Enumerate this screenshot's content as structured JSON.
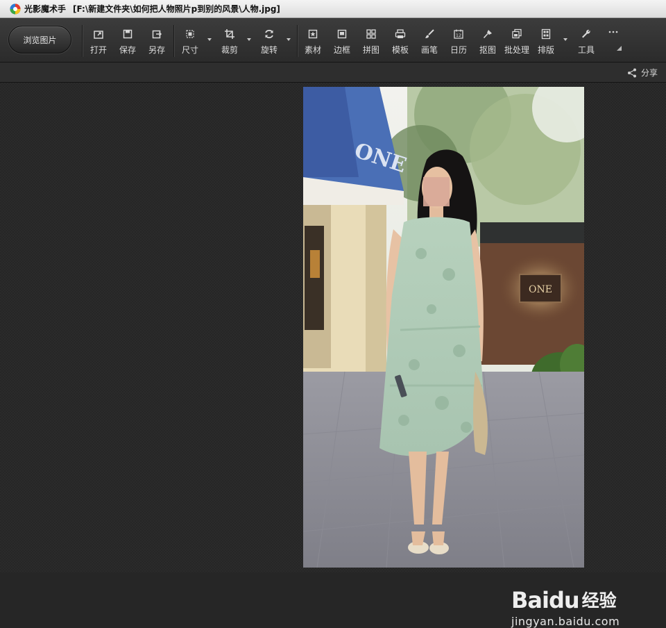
{
  "window": {
    "app_name": "光影魔术手",
    "file_path": "[F:\\新建文件夹\\如何把人物照片p到别的风景\\人物.jpg]"
  },
  "toolbar": {
    "browse_label": "浏览图片",
    "tools": [
      {
        "label": "打开",
        "icon": "open-icon"
      },
      {
        "label": "保存",
        "icon": "save-icon"
      },
      {
        "label": "另存",
        "icon": "save-as-icon"
      },
      {
        "label": "尺寸",
        "icon": "resize-icon"
      },
      {
        "label": "裁剪",
        "icon": "crop-icon"
      },
      {
        "label": "旋转",
        "icon": "rotate-icon"
      },
      {
        "label": "素材",
        "icon": "material-icon"
      },
      {
        "label": "边框",
        "icon": "border-icon"
      },
      {
        "label": "拼图",
        "icon": "collage-icon"
      },
      {
        "label": "模板",
        "icon": "template-icon"
      },
      {
        "label": "画笔",
        "icon": "brush-icon"
      },
      {
        "label": "日历",
        "icon": "calendar-icon"
      },
      {
        "label": "抠图",
        "icon": "cutout-icon"
      },
      {
        "label": "批处理",
        "icon": "batch-icon"
      },
      {
        "label": "排版",
        "icon": "layout-icon"
      },
      {
        "label": "工具",
        "icon": "wrench-icon"
      }
    ],
    "calendar_number": "12",
    "more_icon": "more-icon"
  },
  "subbar": {
    "share_label": "分享"
  },
  "photo": {
    "store_sign": "ONE",
    "watermark_brand": "Baidu",
    "watermark_cn": "经验",
    "watermark_url": "jingyan.baidu.com"
  }
}
